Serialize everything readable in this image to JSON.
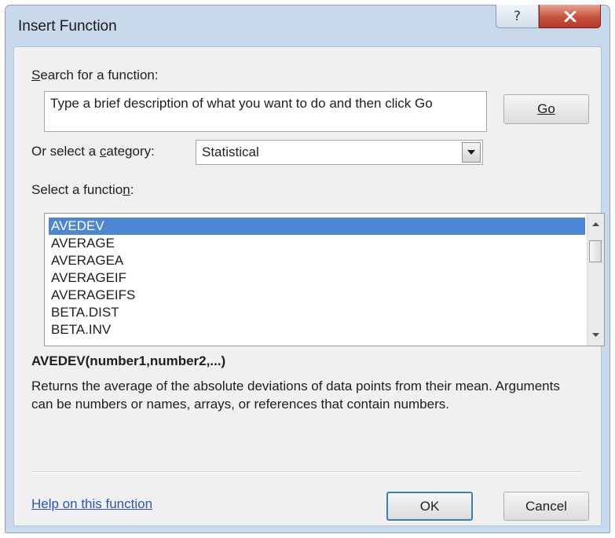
{
  "window": {
    "title": "Insert Function"
  },
  "titlebar": {
    "help_glyph": "?",
    "close_glyph": "X"
  },
  "search": {
    "label": "Search for a function:",
    "mnemonic": "S",
    "label_rest": "earch for a function:",
    "value": "Type a brief description of what you want to do and then click Go",
    "go_button": "Go"
  },
  "category": {
    "label_pre": "Or select a ",
    "label_mnemonic": "c",
    "label_post": "ategory:",
    "selected": "Statistical"
  },
  "functions": {
    "label_pre": "Select a functio",
    "label_mnemonic": "n",
    "label_post": ":",
    "items": [
      "AVEDEV",
      "AVERAGE",
      "AVERAGEA",
      "AVERAGEIF",
      "AVERAGEIFS",
      "BETA.DIST",
      "BETA.INV"
    ],
    "selected_index": 0
  },
  "details": {
    "signature": "AVEDEV(number1,number2,...)",
    "description": "Returns the average of the absolute deviations of data points from their mean. Arguments can be numbers or names, arrays, or references that contain numbers."
  },
  "footer": {
    "help_link": "Help on this function",
    "ok_button": "OK",
    "cancel_button": "Cancel"
  },
  "colors": {
    "selection": "#4c86d4",
    "close_button": "#c7503d",
    "link": "#2a55b8",
    "default_button_border": "#3c7fb1"
  },
  "icons": {
    "close": "close-icon",
    "help": "help-icon",
    "dropdown": "chevron-down-icon",
    "scroll_up": "scroll-up-icon",
    "scroll_down": "scroll-down-icon"
  }
}
